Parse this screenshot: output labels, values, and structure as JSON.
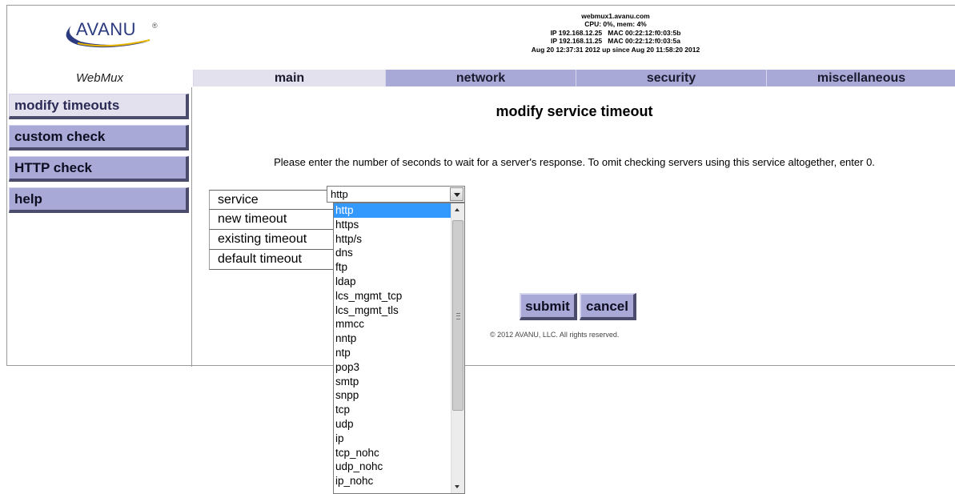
{
  "header": {
    "logo_text": "AVANU",
    "sysinfo": [
      "webmux1.avanu.com",
      "CPU: 0%, mem: 4%",
      "IP 192.168.12.25   MAC 00:22:12:f0:03:5b",
      "IP 192.168.11.25   MAC 00:22:12:f0:03:5a",
      "Aug 20 12:37:31 2012 up since Aug 20 11:58:20 2012"
    ]
  },
  "brand": "WebMux",
  "tabs": [
    "main",
    "network",
    "security",
    "miscellaneous"
  ],
  "active_tab": "main",
  "sidebar": {
    "items": [
      "modify timeouts",
      "custom check",
      "HTTP check",
      "help"
    ],
    "active": "modify timeouts"
  },
  "main": {
    "title": "modify service timeout",
    "instructions": "Please enter the number of seconds to wait for a server's response. To omit checking servers using this service altogether, enter 0.",
    "form_labels": [
      "service",
      "new timeout",
      "existing timeout",
      "default timeout"
    ],
    "service_select": {
      "value": "http",
      "options": [
        "http",
        "https",
        "http/s",
        "dns",
        "ftp",
        "ldap",
        "lcs_mgmt_tcp",
        "lcs_mgmt_tls",
        "mmcc",
        "nntp",
        "ntp",
        "pop3",
        "smtp",
        "snpp",
        "tcp",
        "udp",
        "ip",
        "tcp_nohc",
        "udp_nohc",
        "ip_nohc"
      ]
    },
    "submit_label": "submit",
    "cancel_label": "cancel",
    "copyright": "© 2012 AVANU, LLC. All rights reserved."
  },
  "colors": {
    "tab_bg": "#a9a9d7",
    "tab_active_bg": "#e4e1ef",
    "selection": "#3399ff",
    "logo": "#2c3b7f"
  }
}
